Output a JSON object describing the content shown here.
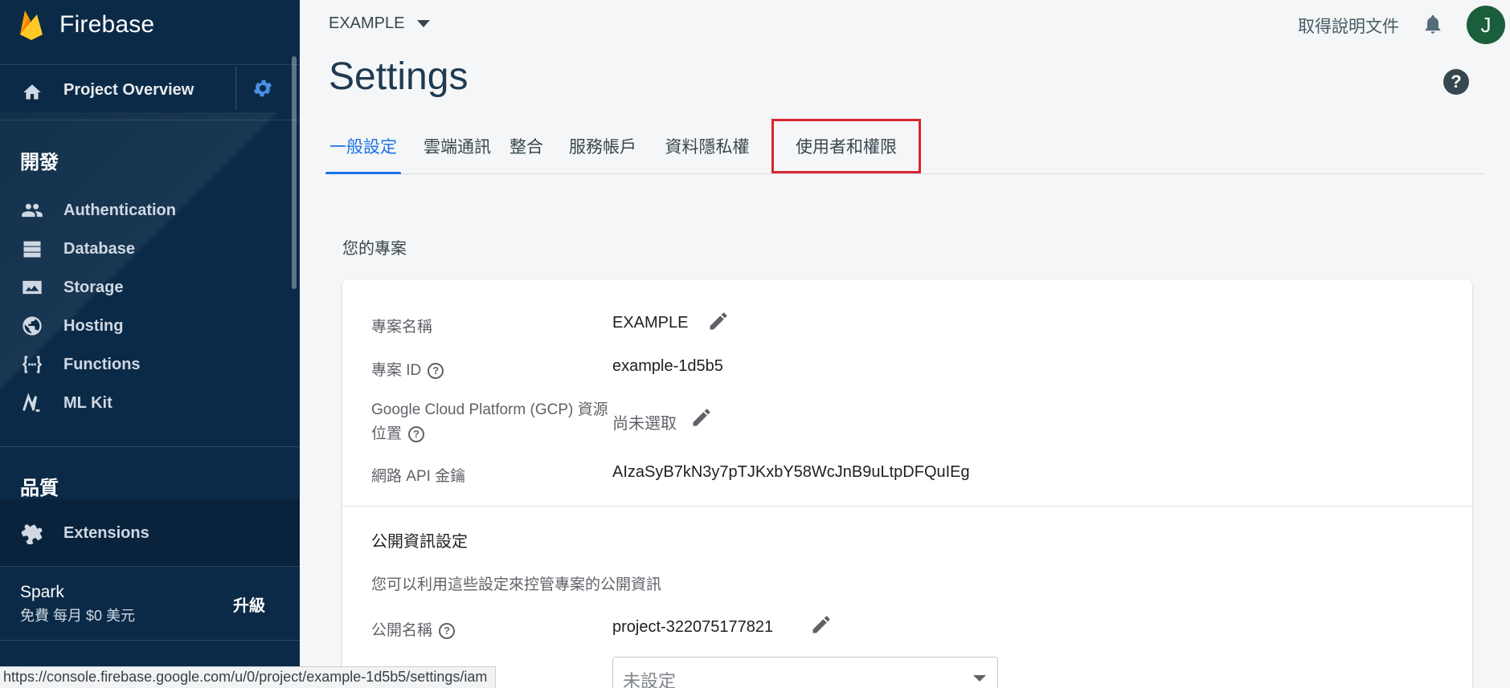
{
  "sidebar": {
    "brand": "Firebase",
    "overview_label": "Project Overview",
    "section_develop": "開發",
    "develop_items": [
      {
        "label": "Authentication",
        "icon": "people-icon"
      },
      {
        "label": "Database",
        "icon": "database-icon"
      },
      {
        "label": "Storage",
        "icon": "image-icon"
      },
      {
        "label": "Hosting",
        "icon": "globe-icon"
      },
      {
        "label": "Functions",
        "icon": "functions-icon"
      },
      {
        "label": "ML Kit",
        "icon": "ml-kit-icon"
      }
    ],
    "section_quality": "品質",
    "extensions_label": "Extensions",
    "plan_name": "Spark",
    "plan_desc": "免費 每月 $0 美元",
    "upgrade_label": "升級"
  },
  "header": {
    "project_name": "EXAMPLE",
    "help_docs": "取得說明文件",
    "avatar_initial": "J",
    "page_title": "Settings"
  },
  "tabs": [
    {
      "label": "一般設定",
      "active": true
    },
    {
      "label": "雲端通訊"
    },
    {
      "label": "整合"
    },
    {
      "label": "服務帳戶"
    },
    {
      "label": "資料隱私權"
    },
    {
      "label": "使用者和權限",
      "highlighted": true
    }
  ],
  "section": {
    "your_project": "您的專案"
  },
  "card": {
    "project_name_label": "專案名稱",
    "project_name_value": "EXAMPLE",
    "project_id_label": "專案 ID",
    "project_id_value": "example-1d5b5",
    "gcp_label_line1": "Google Cloud Platform (GCP) 資源",
    "gcp_label_line2": "位置",
    "gcp_value": "尚未選取",
    "api_key_label": "網路 API 金鑰",
    "api_key_value": "AIzaSyB7kN3y7pTJKxbY58WcJnB9uLtpDFQuIEg",
    "public_title": "公開資訊設定",
    "public_desc": "您可以利用這些設定來控管專案的公開資訊",
    "public_name_label": "公開名稱",
    "public_name_value": "project-322075177821",
    "support_email_value": "未設定"
  },
  "status_bar": {
    "url": "https://console.firebase.google.com/u/0/project/example-1d5b5/settings/iam"
  },
  "colors": {
    "sidebar_bg": "#0b2a47",
    "accent": "#1a73e8",
    "highlight": "#d9252f"
  }
}
